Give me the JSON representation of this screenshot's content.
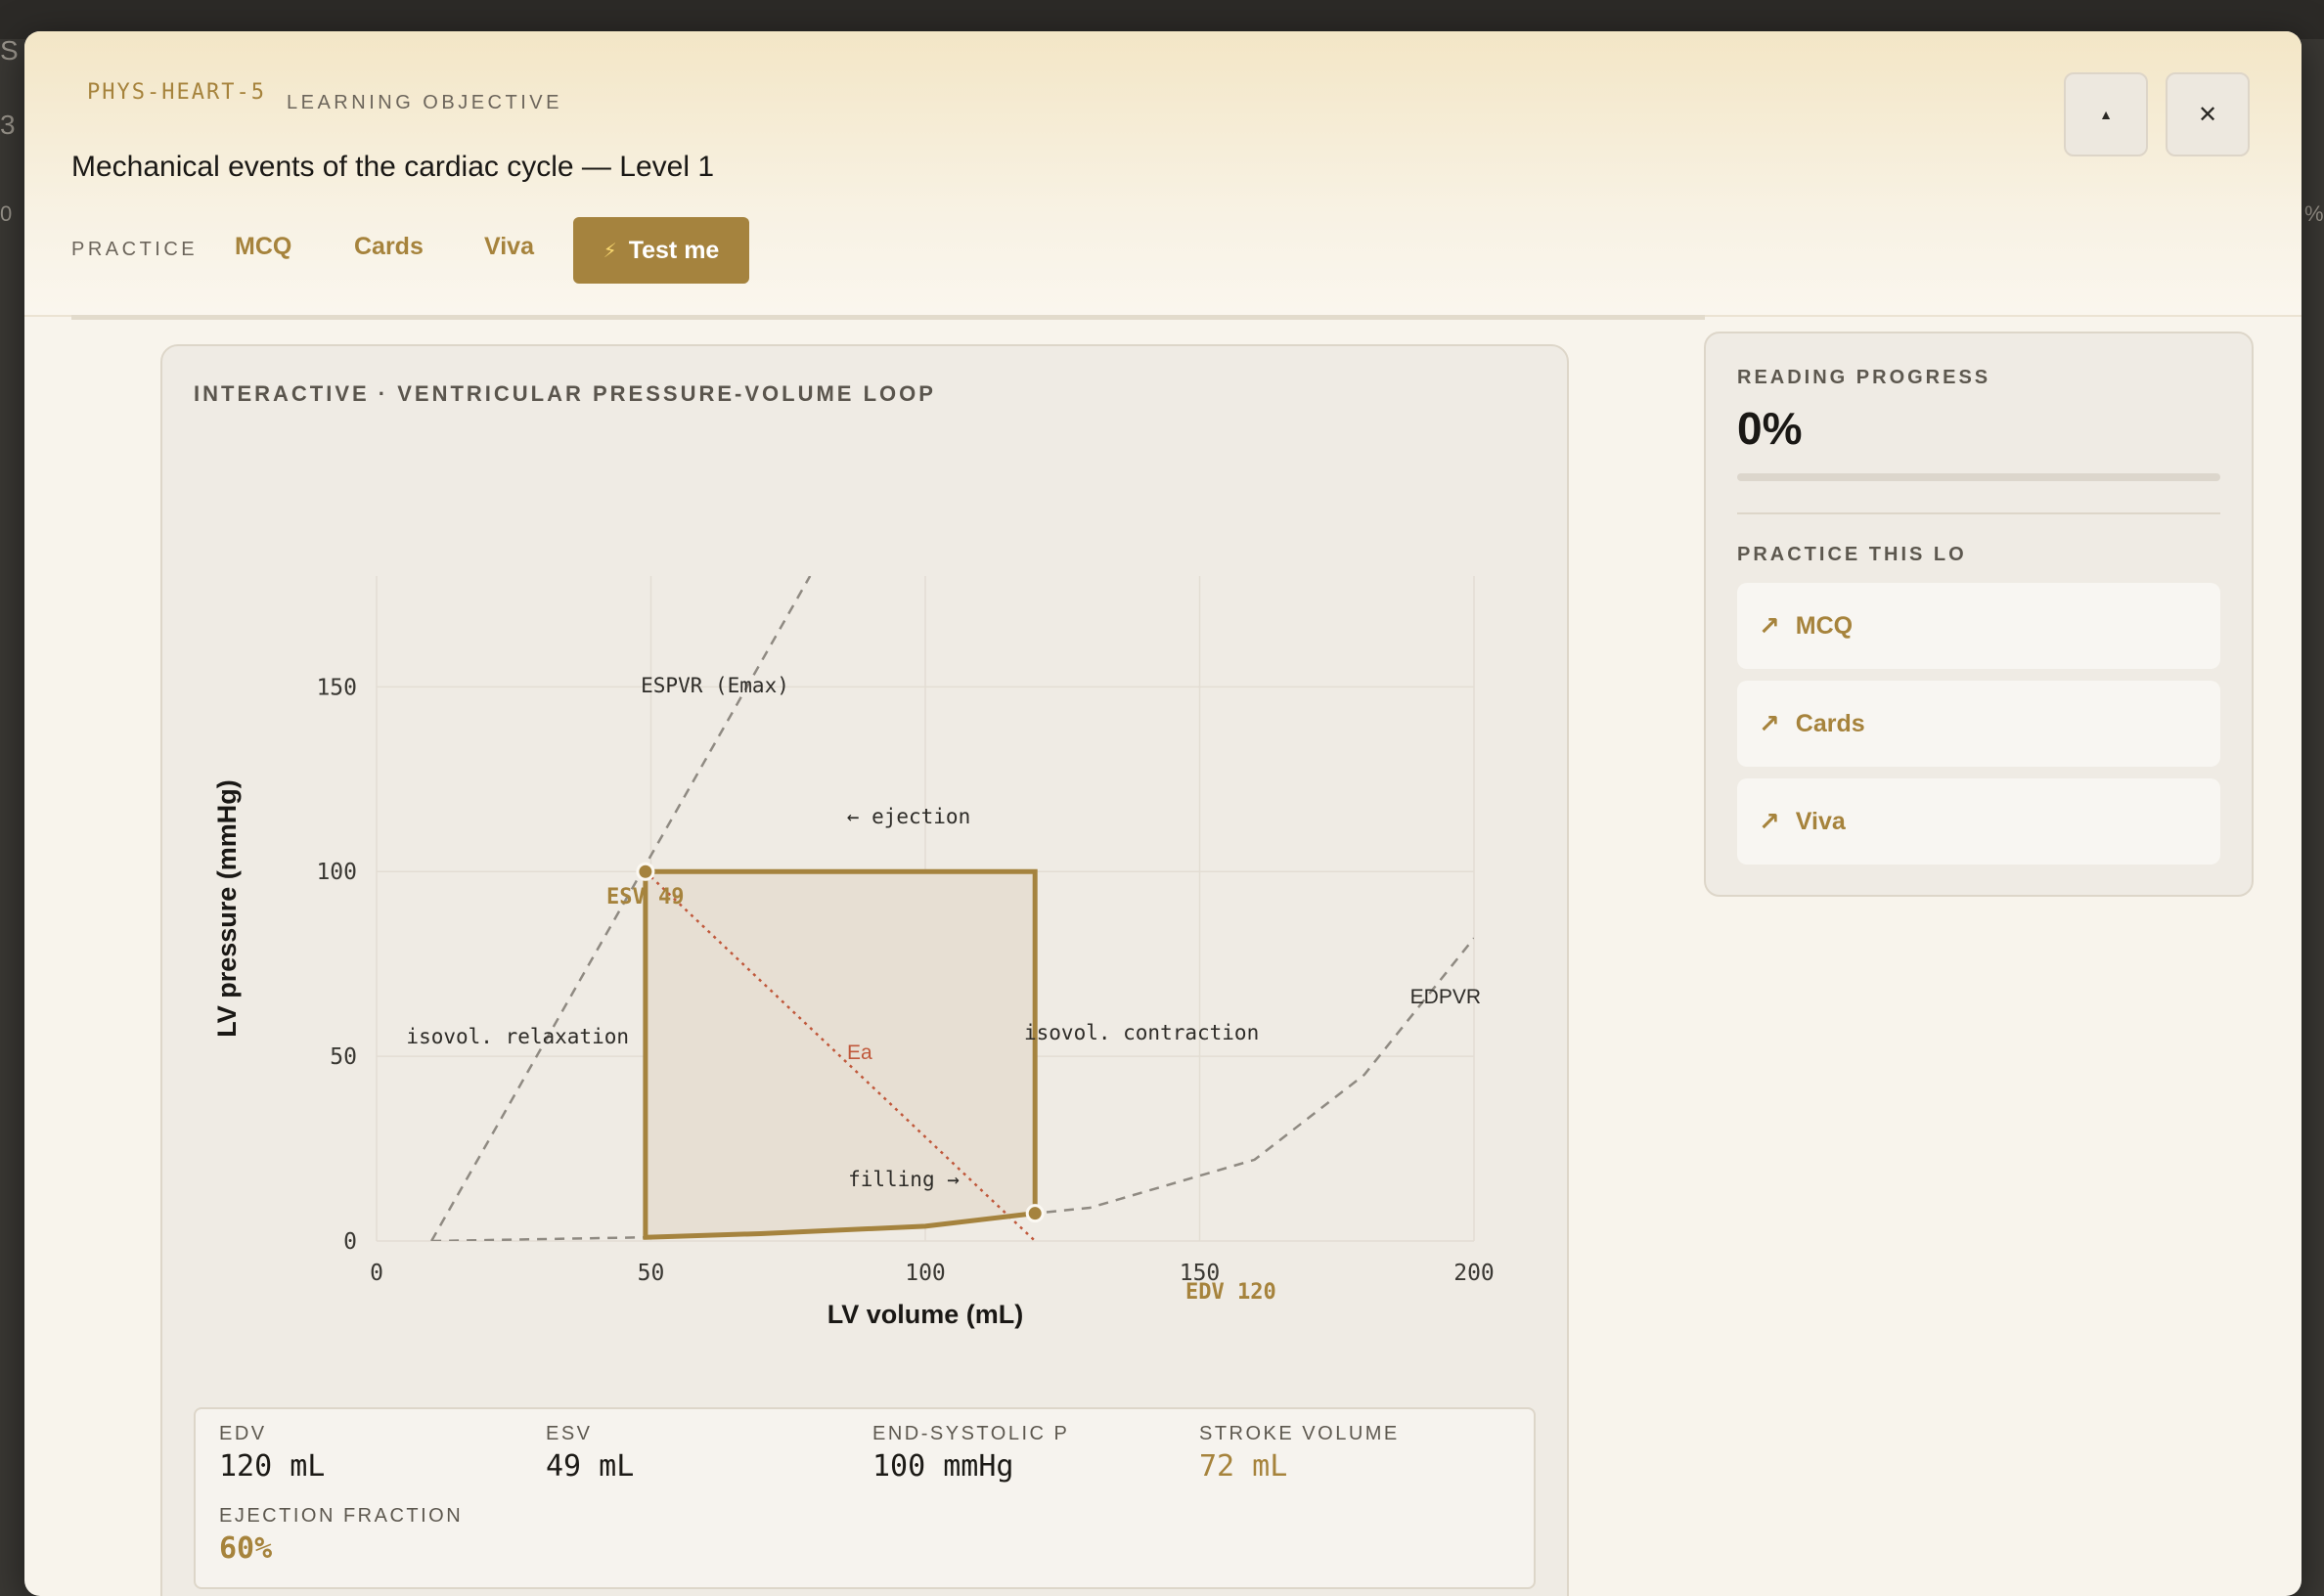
{
  "background": {
    "fragment_1": "S",
    "fragment_2": "3",
    "fragment_3": "0",
    "fragment_4": "%"
  },
  "header": {
    "lo_code": "PHYS-HEART-5",
    "lo_kind": "LEARNING OBJECTIVE",
    "title": "Mechanical events of the cardiac cycle — Level 1",
    "practice_label": "PRACTICE",
    "tabs": [
      {
        "label": "MCQ"
      },
      {
        "label": "Cards"
      },
      {
        "label": "Viva"
      }
    ],
    "test_button": "Test me",
    "collapse_icon": "▲",
    "close_icon": "✕"
  },
  "card": {
    "title": "INTERACTIVE · VENTRICULAR PRESSURE-VOLUME LOOP"
  },
  "chart_data": {
    "type": "line",
    "xlabel": "LV volume (mL)",
    "ylabel": "LV pressure (mmHg)",
    "xlim": [
      0,
      200
    ],
    "ylim": [
      0,
      180
    ],
    "xticks": [
      0,
      50,
      100,
      150,
      200
    ],
    "yticks": [
      0,
      50,
      100,
      150
    ],
    "grid": true,
    "loop": [
      [
        49,
        1
      ],
      [
        70,
        2
      ],
      [
        100,
        4
      ],
      [
        120,
        7.5
      ],
      [
        120,
        100
      ],
      [
        49,
        100
      ]
    ],
    "espvr": [
      [
        10,
        0
      ],
      [
        79,
        180
      ]
    ],
    "edpvr": [
      [
        10,
        0
      ],
      [
        49,
        1
      ],
      [
        70,
        2
      ],
      [
        100,
        4
      ],
      [
        120,
        7.5
      ],
      [
        130,
        9
      ],
      [
        160,
        22
      ],
      [
        180,
        45
      ],
      [
        200,
        82
      ]
    ],
    "ea": [
      [
        49,
        100
      ],
      [
        120,
        0
      ]
    ],
    "labels": {
      "espvr": "ESPVR (Emax)",
      "edpvr": "EDPVR",
      "esv": "ESV 49",
      "edv": "EDV 120",
      "ejection": "← ejection",
      "filling": "filling →",
      "isovol_relax": "isovol. relaxation",
      "isovol_contract": "isovol. contraction",
      "ea": "Ea"
    },
    "colors": {
      "loop": "#a5833e",
      "loop_fill": "#e7dfd3",
      "ea": "#c0583b",
      "dashed": "#8f8a82",
      "grid": "#e3ddd3"
    }
  },
  "stats": {
    "edv_label": "EDV",
    "edv_value": "120 mL",
    "esv_label": "ESV",
    "esv_value": "49 mL",
    "esp_label": "END-SYSTOLIC P",
    "esp_value": "100 mmHg",
    "sv_label": "STROKE VOLUME",
    "sv_value": "72 mL",
    "ef_label": "EJECTION FRACTION",
    "ef_value": "60%"
  },
  "side": {
    "progress_label": "READING PROGRESS",
    "progress_value": "0%",
    "progress_fraction": 0,
    "practice_label": "PRACTICE THIS LO",
    "items": [
      {
        "label": "MCQ"
      },
      {
        "label": "Cards"
      },
      {
        "label": "Viva"
      }
    ],
    "item_icon": "↗"
  }
}
